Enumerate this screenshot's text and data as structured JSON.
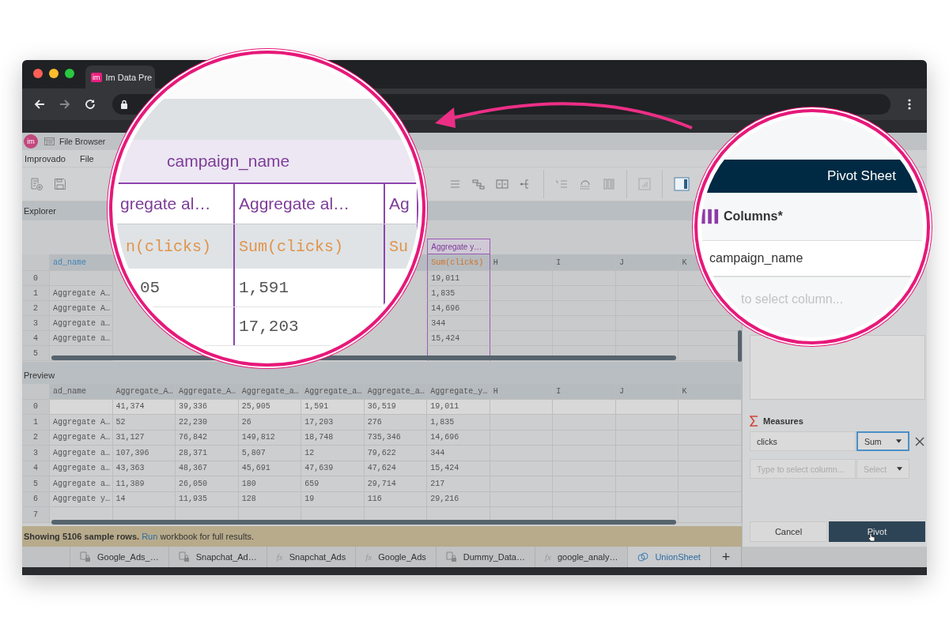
{
  "browser": {
    "favicon": "im",
    "tab_title": "Im Data Pre"
  },
  "app": {
    "logo": "im",
    "file_browser": "File Browser",
    "menu": [
      "Improvado",
      "File"
    ]
  },
  "explorer": {
    "label": "Explorer",
    "field_header": "ad_name",
    "group_header": "Aggregate y…",
    "measure_header": "Sum(clicks)",
    "letter_columns": [
      "H",
      "I",
      "J",
      "K"
    ],
    "rows": [
      {
        "index": "0",
        "value": "19,011"
      },
      {
        "index": "1",
        "ad_name": "Aggregate A…",
        "value": "1,835"
      },
      {
        "index": "2",
        "ad_name": "Aggregate A…",
        "value": "14,696"
      },
      {
        "index": "3",
        "ad_name": "Aggregate a…",
        "value": "344"
      },
      {
        "index": "4",
        "ad_name": "Aggregate a…",
        "value": "15,424"
      },
      {
        "index": "5"
      }
    ]
  },
  "preview": {
    "label": "Preview",
    "columns": [
      "ad_name",
      "Aggregate_A…",
      "Aggregate_A…",
      "Aggregate_a…",
      "Aggregate_a…",
      "Aggregate_a…",
      "Aggregate_y…",
      "H",
      "I",
      "J",
      "K"
    ],
    "rows": [
      {
        "index": "0",
        "cells": [
          null,
          "41,374",
          "39,336",
          "25,905",
          "1,591",
          "36,519",
          "19,011"
        ]
      },
      {
        "index": "1",
        "cells": [
          "Aggregate A…",
          "52",
          "22,230",
          "26",
          "17,203",
          "276",
          "1,835"
        ]
      },
      {
        "index": "2",
        "cells": [
          "Aggregate A…",
          "31,127",
          "76,842",
          "149,812",
          "18,748",
          "735,346",
          "14,696"
        ]
      },
      {
        "index": "3",
        "cells": [
          "Aggregate a…",
          "107,396",
          "28,371",
          "5,807",
          "12",
          "79,622",
          "344"
        ]
      },
      {
        "index": "4",
        "cells": [
          "Aggregate a…",
          "43,363",
          "48,367",
          "45,691",
          "47,639",
          "47,624",
          "15,424"
        ]
      },
      {
        "index": "5",
        "cells": [
          "Aggregate a…",
          "11,389",
          "26,050",
          "180",
          "659",
          "29,714",
          "217"
        ]
      },
      {
        "index": "6",
        "cells": [
          "Aggregate y…",
          "14",
          "11,935",
          "128",
          "19",
          "116",
          "29,216"
        ]
      },
      {
        "index": "7"
      }
    ]
  },
  "status": {
    "lead": "Showing 5106 sample rows.",
    "link": "Run",
    "rest": "workbook for full results."
  },
  "sheets": [
    {
      "label": "Google_Ads_…",
      "kind": "locked",
      "selected": false
    },
    {
      "label": "Snapchat_Ad…",
      "kind": "locked",
      "selected": false
    },
    {
      "label": "Snapchat_Ads",
      "kind": "formula",
      "icon": "fx",
      "selected": false
    },
    {
      "label": "Google_Ads",
      "kind": "formula",
      "icon": "fx",
      "selected": false
    },
    {
      "label": "Dummy_Data…",
      "kind": "locked",
      "selected": false
    },
    {
      "label": "google_analy…",
      "kind": "formula",
      "icon": "fx",
      "selected": false
    },
    {
      "label": "UnionSheet",
      "kind": "union",
      "selected": true
    }
  ],
  "add_sheet": "+",
  "panel": {
    "measures_label": "Measures",
    "measures": [
      {
        "kind": "filled",
        "column": "clicks",
        "aggregate": "Sum",
        "focused": true
      },
      {
        "kind": "empty",
        "placeholder": "Type to select column...",
        "aggregate": "Select",
        "focused": false
      }
    ],
    "buttons": [
      {
        "label": "Cancel",
        "kind": "secondary"
      },
      {
        "label": "Pivot",
        "kind": "primary"
      }
    ]
  },
  "lens_left": {
    "group_header": "campaign_name",
    "headers": [
      "gregate al…",
      "Aggregate al…",
      "Ag"
    ],
    "measures": [
      "n(clicks)",
      "Sum(clicks)",
      "Su"
    ],
    "rows": [
      [
        "05",
        "1,591",
        null
      ],
      [
        null,
        "17,203",
        null
      ]
    ]
  },
  "lens_right": {
    "title": "Pivot Sheet",
    "columns_label": "Columns*",
    "column_value": "campaign_name",
    "placeholder": "to select column..."
  }
}
